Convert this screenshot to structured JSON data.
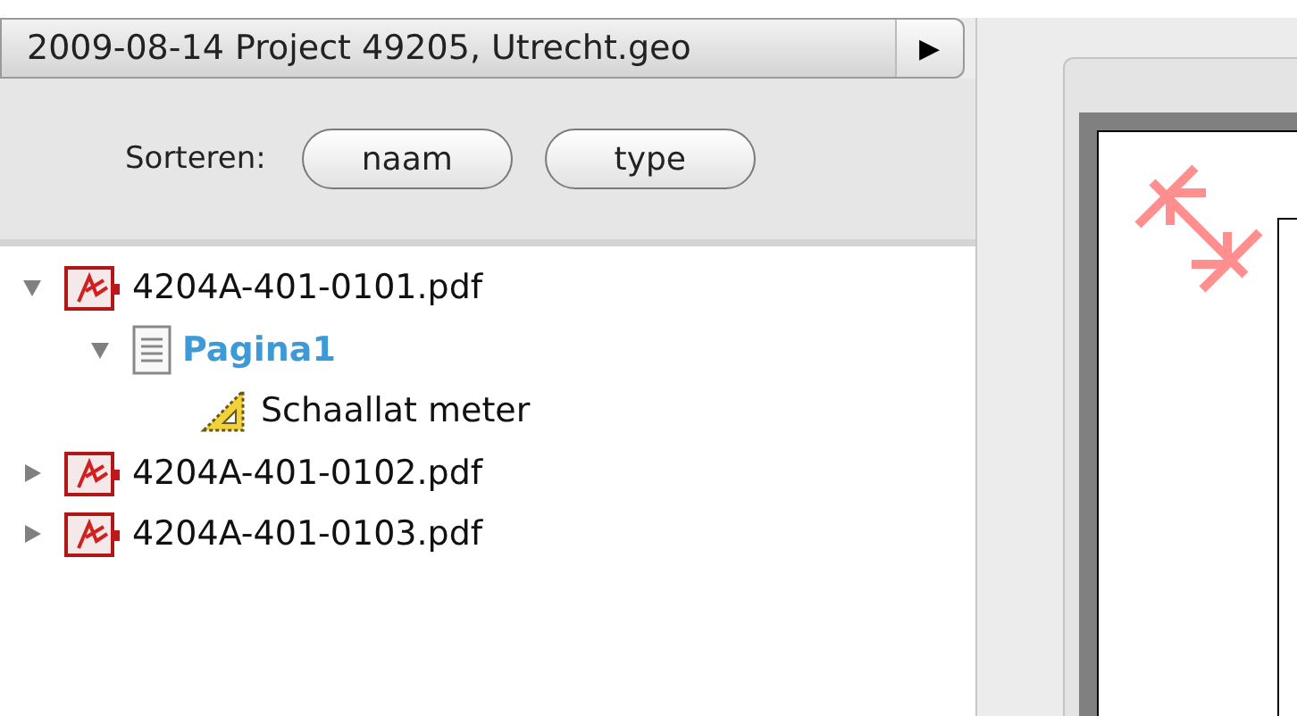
{
  "document_bar": {
    "title": "2009-08-14 Project 49205, Utrecht.geo",
    "menu_arrow": "▶"
  },
  "sort": {
    "label": "Sorteren:",
    "buttons": [
      "naam",
      "type"
    ]
  },
  "tree": [
    {
      "kind": "pdf",
      "label": "4204A-401-0101.pdf",
      "expanded": true,
      "selected": false,
      "children": [
        {
          "kind": "page",
          "label": "Pagina1",
          "expanded": true,
          "selected": true,
          "children": [
            {
              "kind": "measure",
              "label": "Schaallat meter",
              "selected": false
            }
          ]
        }
      ]
    },
    {
      "kind": "pdf",
      "label": "4204A-401-0102.pdf",
      "expanded": false,
      "selected": false
    },
    {
      "kind": "pdf",
      "label": "4204A-401-0103.pdf",
      "expanded": false,
      "selected": false
    }
  ]
}
